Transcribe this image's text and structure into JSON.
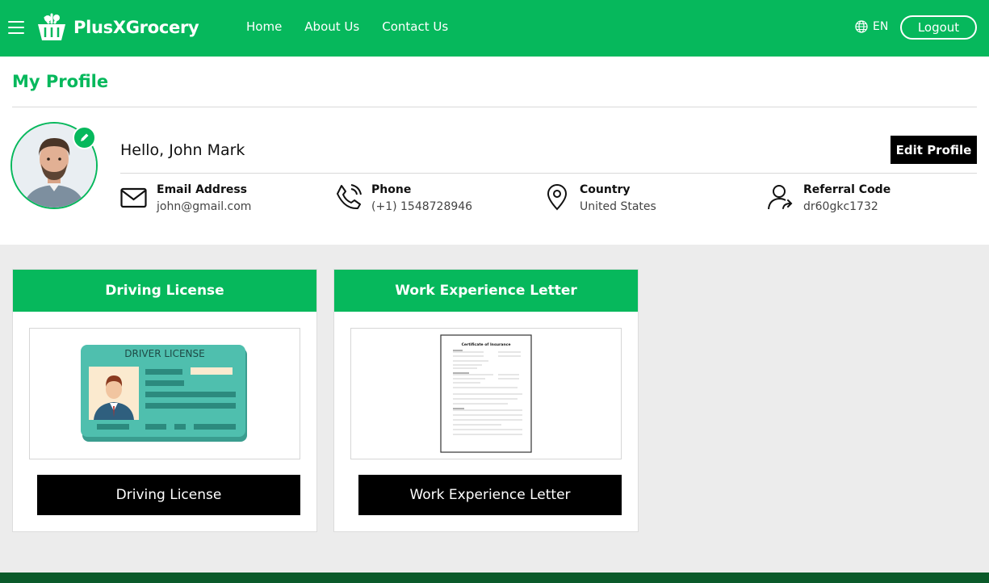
{
  "header": {
    "brand": "PlusXGrocery",
    "nav": [
      "Home",
      "About Us",
      "Contact Us"
    ],
    "language": "EN",
    "logout_label": "Logout"
  },
  "profile": {
    "title": "My Profile",
    "greeting": "Hello, John Mark",
    "edit_label": "Edit Profile",
    "fields": {
      "email": {
        "label": "Email Address",
        "value": "john@gmail.com"
      },
      "phone": {
        "label": "Phone",
        "value": "(+1) 1548728946"
      },
      "country": {
        "label": "Country",
        "value": "United States"
      },
      "referral": {
        "label": "Referral Code",
        "value": "dr60gkc1732"
      }
    }
  },
  "documents": [
    {
      "title": "Driving License",
      "button": "Driving License",
      "license_heading": "DRIVER LICENSE"
    },
    {
      "title": "Work Experience Letter",
      "button": "Work Experience Letter",
      "doc_heading": "Certificate of Insurance"
    }
  ],
  "colors": {
    "brand": "#06b85c",
    "footer": "#0b5a2a",
    "license_card": "#4fbfae"
  },
  "icons": [
    "menu-icon",
    "basket-logo-icon",
    "globe-icon",
    "pencil-icon",
    "mail-icon",
    "phone-icon",
    "location-pin-icon",
    "user-share-icon"
  ]
}
